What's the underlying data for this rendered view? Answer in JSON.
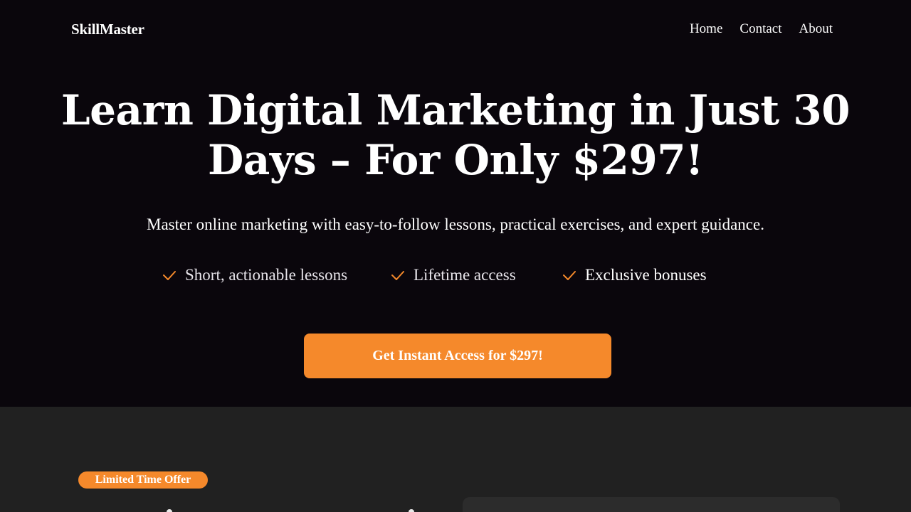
{
  "nav": {
    "brand": "SkillMaster",
    "links": [
      "Home",
      "Contact",
      "About"
    ]
  },
  "hero": {
    "headline_line1": "Learn Digital Marketing in Just 30",
    "headline_line2": "Days – For Only $297!",
    "subtitle": "Master online marketing with easy-to-follow lessons, practical exercises, and expert guidance.",
    "features": [
      "Short, actionable lessons",
      "Lifetime access",
      "Exclusive bonuses"
    ],
    "feature_icon": "check-icon",
    "cta_label": "Get Instant Access for $297!"
  },
  "offer": {
    "badge": "Limited Time Offer"
  },
  "colors": {
    "background": "#0a060c",
    "accent": "#f5892b",
    "section_bg": "#212121",
    "card_bg": "#2c2c2c"
  }
}
